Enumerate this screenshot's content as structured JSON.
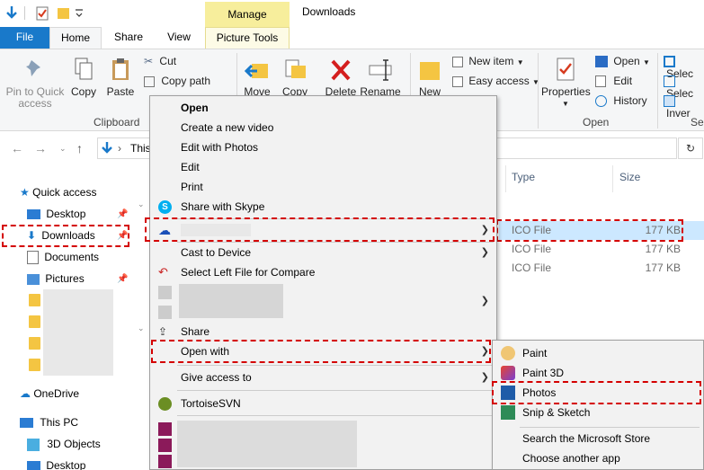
{
  "window": {
    "title": "Downloads",
    "manage_tab": "Manage"
  },
  "tabs": {
    "file": "File",
    "home": "Home",
    "share": "Share",
    "view": "View",
    "picture_tools": "Picture Tools"
  },
  "ribbon": {
    "pin_quick_access": "Pin to Quick access",
    "copy": "Copy",
    "paste": "Paste",
    "cut": "Cut",
    "copy_path": "Copy path",
    "clipboard_group": "Clipboard",
    "move_to": "Move",
    "copy_to": "Copy",
    "delete": "Delete",
    "rename": "Rename",
    "new_folder": "New",
    "new_item": "New item",
    "easy_access": "Easy access",
    "properties": "Properties",
    "open": "Open",
    "edit": "Edit",
    "history": "History",
    "open_group": "Open",
    "select_all": "Selec",
    "select_none": "Selec",
    "invert_selection": "Inver",
    "select_group": "Se"
  },
  "address": {
    "path_fragment": "This"
  },
  "nav": {
    "quick_access": "Quick access",
    "desktop": "Desktop",
    "downloads": "Downloads",
    "documents": "Documents",
    "pictures": "Pictures",
    "onedrive": "OneDrive",
    "this_pc": "This PC",
    "objects_3d": "3D Objects",
    "desktop2": "Desktop"
  },
  "file_list": {
    "col_type": "Type",
    "col_size": "Size",
    "rows": [
      {
        "type": "ICO File",
        "size": "177 KB"
      },
      {
        "type": "ICO File",
        "size": "177 KB"
      },
      {
        "type": "ICO File",
        "size": "177 KB"
      }
    ]
  },
  "context_menu": {
    "open": "Open",
    "create_video": "Create a new video",
    "edit_photos": "Edit with Photos",
    "edit": "Edit",
    "print": "Print",
    "share_skype": "Share with Skype",
    "cast": "Cast to Device",
    "select_left": "Select Left File for Compare",
    "share": "Share",
    "open_with": "Open with",
    "give_access": "Give access to",
    "tortoise": "TortoiseSVN"
  },
  "open_with_menu": {
    "paint": "Paint",
    "paint3d": "Paint 3D",
    "photos": "Photos",
    "snip": "Snip & Sketch",
    "store": "Search the Microsoft Store",
    "choose": "Choose another app"
  },
  "colors": {
    "accent": "#1979ca",
    "manage_tab": "#f7ee9c",
    "highlight": "#d40000",
    "selection": "#cce8ff"
  }
}
